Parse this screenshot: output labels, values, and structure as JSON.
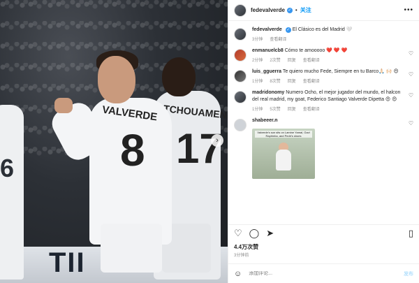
{
  "post": {
    "username": "fedevalverde",
    "follow_label": "关注",
    "caption_text": "El Clásico es del Madrid 🤍",
    "caption_time": "3分钟",
    "caption_translate": "查看翻译",
    "jersey_main_name": "VALVERDE",
    "jersey_main_number": "8",
    "jersey_back_name": "TCHOUAMENI",
    "jersey_back_number": "17",
    "jersey_left_number": "6",
    "board_text": "TII"
  },
  "comments": [
    {
      "username": "enmanuelcb8",
      "text": "Cómo te amooooo ❤️ ❤️ ❤️",
      "time": "2分钟",
      "likes": "2次赞",
      "reply": "回复",
      "translate": "查看翻译"
    },
    {
      "username": "luis_gguerra",
      "text": "Te quiero mucho Fede, Siempre en tu Barco🙏🏻 🙌🏻 😍",
      "time": "1分钟",
      "likes": "8次赞",
      "reply": "回复",
      "translate": "查看翻译"
    },
    {
      "username": "madridonomy",
      "text": "Numero Ocho, el mejor jugador del mundo, el halcon del real madrid, my goat, Federico Santiago Valverde Dipetta 😍 😍",
      "time": "1分钟",
      "likes": "5次赞",
      "reply": "回复",
      "translate": "查看翻译"
    },
    {
      "username": "shabeeer.n",
      "image_caption": "Valverde's son sits on Lamine Yamal, Gavi Raphinha, and Pedri's shoes"
    }
  ],
  "footer": {
    "likes_count": "4.4万次赞",
    "post_time": "3分钟前",
    "comment_placeholder": "添加评论...",
    "post_button": "发布"
  }
}
